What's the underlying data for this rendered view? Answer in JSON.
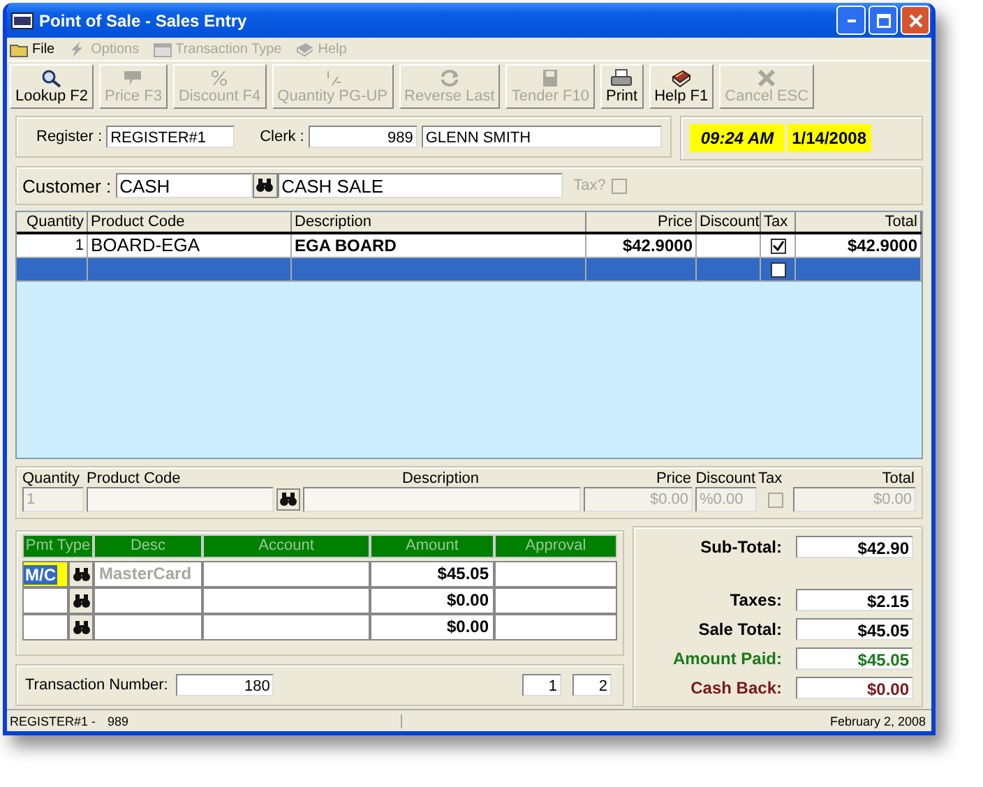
{
  "window": {
    "title": "Point of Sale - Sales Entry"
  },
  "menu": [
    {
      "label": "File",
      "disabled": false
    },
    {
      "label": "Options",
      "disabled": true
    },
    {
      "label": "Transaction Type",
      "disabled": true
    },
    {
      "label": "Help",
      "disabled": true
    }
  ],
  "toolbar": [
    {
      "label": "Lookup F2",
      "disabled": false
    },
    {
      "label": "Price F3",
      "disabled": true
    },
    {
      "label": "Discount F4",
      "disabled": true
    },
    {
      "label": "Quantity PG-UP",
      "disabled": true
    },
    {
      "label": "Reverse Last",
      "disabled": true
    },
    {
      "label": "Tender F10",
      "disabled": true
    },
    {
      "label": "Print",
      "disabled": false
    },
    {
      "label": "Help F1",
      "disabled": false
    },
    {
      "label": "Cancel ESC",
      "disabled": true
    }
  ],
  "register": {
    "label": "Register :",
    "value": "REGISTER#1"
  },
  "clerk": {
    "label": "Clerk :",
    "code": "989",
    "name": "GLENN SMITH"
  },
  "clock": {
    "time": "09:24 AM",
    "date": "1/14/2008"
  },
  "customer": {
    "label": "Customer :",
    "code": "CASH",
    "name": "CASH SALE",
    "tax_label": "Tax?",
    "tax_checked": false
  },
  "grid": {
    "columns": [
      "Quantity",
      "Product Code",
      "Description",
      "Price",
      "Discount",
      "Tax",
      "Total"
    ],
    "rows": [
      {
        "quantity": "1",
        "product_code": "BOARD-EGA",
        "description": "EGA BOARD",
        "price": "$42.9000",
        "tax": true,
        "total": "$42.9000",
        "selected": false
      },
      {
        "tax": false,
        "selected": true
      }
    ]
  },
  "entry": {
    "labels": [
      "Quantity",
      "Product Code",
      "Description",
      "Price",
      "Discount",
      "Tax",
      "Total"
    ],
    "quantity": "1",
    "price": "$0.00",
    "discount": "%0.00",
    "tax": false,
    "total": "$0.00"
  },
  "payments": {
    "columns": [
      "Pmt Type",
      "Desc",
      "Account",
      "Amount",
      "Approval"
    ],
    "rows": [
      {
        "type": "M/C",
        "desc": "MasterCard",
        "amount": "$45.05",
        "active": true
      },
      {
        "amount": "$0.00",
        "active": false
      },
      {
        "amount": "$0.00",
        "active": false
      }
    ]
  },
  "totals": [
    {
      "label": "Sub-Total:",
      "value": "$42.90",
      "kind": "normal"
    },
    {
      "label": "Taxes:",
      "value": "$2.15",
      "kind": "normal"
    },
    {
      "label": "Sale Total:",
      "value": "$45.05",
      "kind": "normal"
    },
    {
      "label": "Amount Paid:",
      "value": "$45.05",
      "kind": "paid"
    },
    {
      "label": "Cash Back:",
      "value": "$0.00",
      "kind": "change"
    }
  ],
  "transaction": {
    "label": "Transaction Number:",
    "value": "180",
    "pages": [
      "1",
      "2"
    ]
  },
  "status_bar": [
    "REGISTER#1 -",
    "989",
    "February  2, 2008"
  ]
}
